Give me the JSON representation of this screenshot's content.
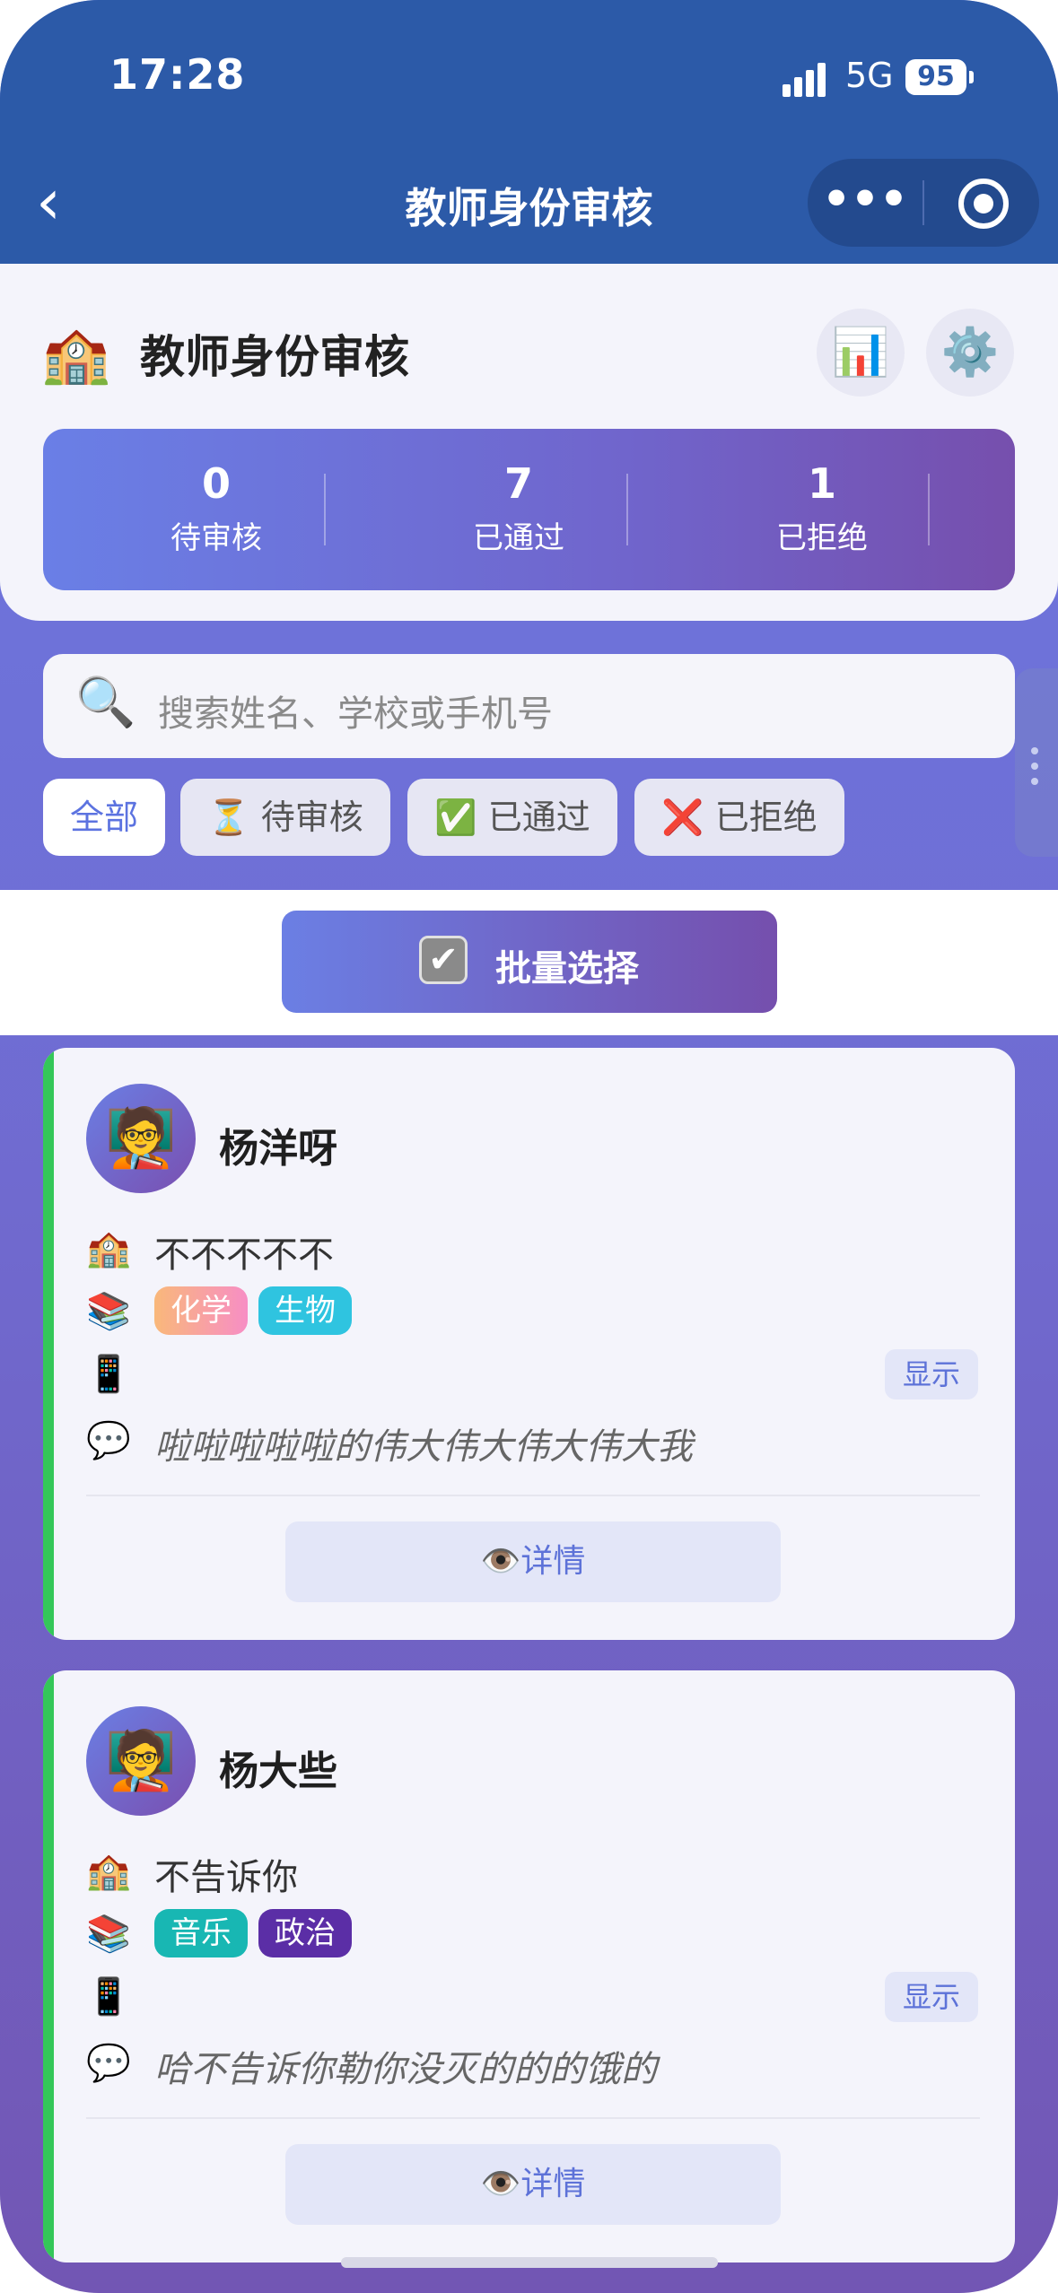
{
  "status_bar": {
    "time": "17:28",
    "network": "5G",
    "battery": "95"
  },
  "nav": {
    "back_icon": "chevron-left-icon",
    "title": "教师身份审核",
    "more_icon": "more-dots-icon",
    "close_icon": "target-icon"
  },
  "header": {
    "icon": "🏫",
    "title": "教师身份审核",
    "chart_icon": "📊",
    "settings_icon": "⚙️",
    "stats": [
      {
        "value": "0",
        "label": "待审核"
      },
      {
        "value": "7",
        "label": "已通过"
      },
      {
        "value": "1",
        "label": "已拒绝"
      }
    ]
  },
  "search": {
    "icon": "🔍",
    "placeholder": "搜索姓名、学校或手机号"
  },
  "filters": [
    {
      "label": "全部",
      "icon": "",
      "active": true
    },
    {
      "label": "待审核",
      "icon": "⏳",
      "active": false
    },
    {
      "label": "已通过",
      "icon": "✅",
      "active": false
    },
    {
      "label": "已拒绝",
      "icon": "❌",
      "active": false
    }
  ],
  "batch": {
    "label": "批量选择",
    "check": "✔"
  },
  "teachers": [
    {
      "avatar": "🧑‍🏫",
      "name": "杨洋呀",
      "school_icon": "🏫",
      "school": "不不不不不",
      "subjects_icon": "📚",
      "subjects": [
        {
          "name": "化学",
          "color": "#f7a8a0"
        },
        {
          "name": "生物",
          "color": "#2fc4e0"
        }
      ],
      "phone_icon": "📱",
      "phone_show": "显示",
      "note_icon": "💬",
      "note": "啦啦啦啦啦的伟大伟大伟大伟大我",
      "detail_label": "👁️详情"
    },
    {
      "avatar": "🧑‍🏫",
      "name": "杨大些",
      "school_icon": "🏫",
      "school": "不告诉你",
      "subjects_icon": "📚",
      "subjects": [
        {
          "name": "音乐",
          "color": "#18b7b3"
        },
        {
          "name": "政治",
          "color": "#5b2ea6"
        }
      ],
      "phone_icon": "📱",
      "phone_show": "显示",
      "note_icon": "💬",
      "note": "哈不告诉你勒你没灭的的的饿的",
      "detail_label": "👁️详情"
    }
  ]
}
